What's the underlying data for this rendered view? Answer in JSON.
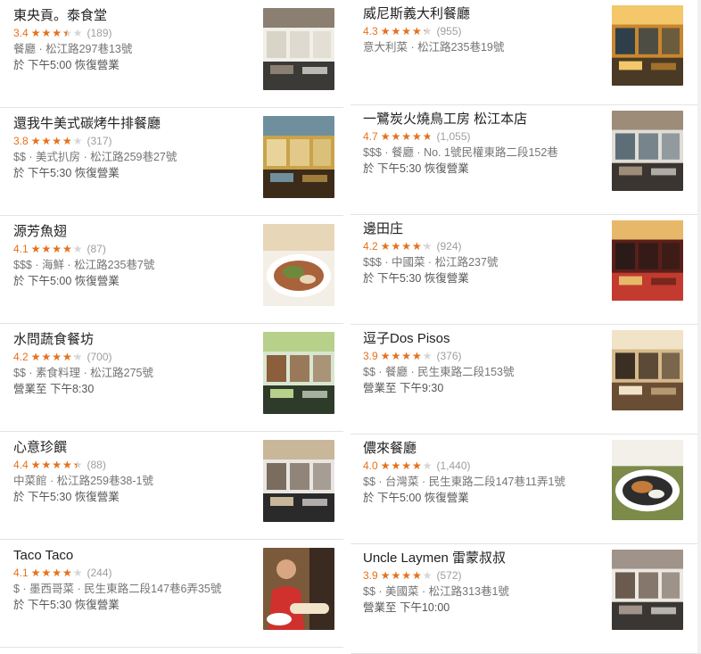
{
  "left": [
    {
      "name": "東央貢。泰食堂",
      "rating": "3.4",
      "fraction": 0.68,
      "count": "(189)",
      "meta": "餐廳 · 松江路297巷13號",
      "hours": "於 下午5:00 恢復營業",
      "icon": "restaurant-photo-icon",
      "palette": [
        "#f2efe8",
        "#3b3a37",
        "#8a7f70",
        "#d9d4c8"
      ]
    },
    {
      "name": "還我牛美式碳烤牛排餐廳",
      "rating": "3.8",
      "fraction": 0.76,
      "count": "(317)",
      "meta": "$$ · 美式扒房 · 松江路259巷27號",
      "hours": "於 下午5:30 恢復營業",
      "icon": "restaurant-photo-icon",
      "palette": [
        "#c9a24a",
        "#3d2b1a",
        "#6f8f9f",
        "#e8d39a"
      ]
    },
    {
      "name": "源芳魚翅",
      "rating": "4.1",
      "fraction": 0.82,
      "count": "(87)",
      "meta": "$$$ · 海鮮 · 松江路235巷7號",
      "hours": "於 下午5:00 恢復營業",
      "icon": "food-photo-icon",
      "palette": [
        "#e7d6b8",
        "#a8633a",
        "#6d8a3c",
        "#f4efe6"
      ]
    },
    {
      "name": "水問蔬食餐坊",
      "rating": "4.2",
      "fraction": 0.84,
      "count": "(700)",
      "meta": "$$ · 素食料理 · 松江路275號",
      "hours": "營業至 下午8:30",
      "icon": "restaurant-photo-icon",
      "palette": [
        "#d8e6d0",
        "#2f3b2a",
        "#b7d08a",
        "#8b5e3c"
      ]
    },
    {
      "name": "心意珍饌",
      "rating": "4.4",
      "fraction": 0.88,
      "count": "(88)",
      "meta": "中菜館 · 松江路259巷38-1號",
      "hours": "於 下午5:30 恢復營業",
      "icon": "restaurant-photo-icon",
      "palette": [
        "#e9e6e1",
        "#2a2a2a",
        "#c9b79a",
        "#7a6d60"
      ]
    },
    {
      "name": "Taco Taco",
      "rating": "4.1",
      "fraction": 0.82,
      "count": "(244)",
      "meta": "$ · 墨西哥菜 · 民生東路二段147巷6弄35號",
      "hours": "於 下午5:30 恢復營業",
      "icon": "chef-photo-icon",
      "palette": [
        "#7a5a3a",
        "#d0312d",
        "#f1e4c9",
        "#3a2a20"
      ]
    }
  ],
  "right": [
    {
      "name": "威尼斯義大利餐廳",
      "rating": "4.3",
      "fraction": 0.86,
      "count": "(955)",
      "meta": "意大利菜 · 松江路235巷19號",
      "hours": "",
      "icon": "restaurant-photo-icon",
      "palette": [
        "#c8872e",
        "#4a3a25",
        "#f3c76a",
        "#2e3f4a"
      ]
    },
    {
      "name": "一鷺炭火燒鳥工房 松江本店",
      "rating": "4.7",
      "fraction": 0.94,
      "count": "(1,055)",
      "meta": "$$$ · 餐廳 · No. 1號民權東路二段152巷",
      "hours": "於 下午5:30 恢復營業",
      "icon": "restaurant-photo-icon",
      "palette": [
        "#e0ddd6",
        "#3a3530",
        "#9c8c78",
        "#5d6e78"
      ]
    },
    {
      "name": "邊田庄",
      "rating": "4.2",
      "fraction": 0.84,
      "count": "(924)",
      "meta": "$$$ · 中國菜 · 松江路237號",
      "hours": "於 下午5:30 恢復營業",
      "icon": "restaurant-photo-icon",
      "palette": [
        "#5a1f1a",
        "#c23b2e",
        "#e8b86a",
        "#2a1a18"
      ]
    },
    {
      "name": "逗子Dos Pisos",
      "rating": "3.9",
      "fraction": 0.78,
      "count": "(376)",
      "meta": "$$ · 餐廳 · 民生東路二段153號",
      "hours": "營業至 下午9:30",
      "icon": "restaurant-photo-icon",
      "palette": [
        "#d6b98c",
        "#6a4e33",
        "#f0e3c8",
        "#3b2e22"
      ]
    },
    {
      "name": "儂來餐廳",
      "rating": "4.0",
      "fraction": 0.8,
      "count": "(1,440)",
      "meta": "$$ · 台灣菜 · 民生東路二段147巷11弄1號",
      "hours": "於 下午5:00 恢復營業",
      "icon": "food-photo-icon",
      "palette": [
        "#f3f0ea",
        "#2d2d2d",
        "#c47a3a",
        "#7c8a4a"
      ]
    },
    {
      "name": "Uncle Laymen 雷蒙叔叔",
      "rating": "3.9",
      "fraction": 0.78,
      "count": "(572)",
      "meta": "$$ · 美國菜 · 松江路313巷1號",
      "hours": "營業至 下午10:00",
      "icon": "restaurant-photo-icon",
      "palette": [
        "#ece8e2",
        "#3a3633",
        "#a0938a",
        "#6b5a4e"
      ]
    }
  ]
}
